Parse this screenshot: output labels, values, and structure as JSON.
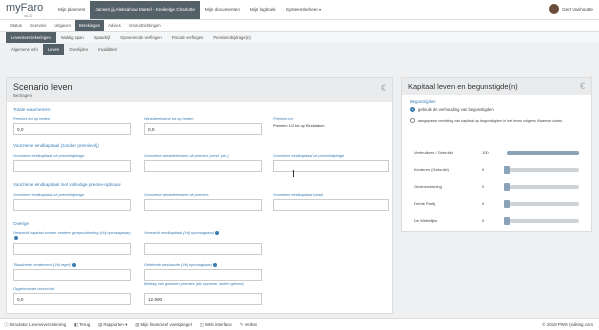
{
  "logo": {
    "name": "myFaro",
    "version": "v4.3"
  },
  "nav": [
    {
      "label": "Mijn planners",
      "active": false
    },
    {
      "label": "Jansen jij Aleksahow Martel - Kreikelge Charlotte",
      "active": true
    },
    {
      "label": "Mijn documenten",
      "active": false
    },
    {
      "label": "Mijn logboek",
      "active": false
    },
    {
      "label": "Systeembeheer",
      "active": false,
      "dropdown": true
    }
  ],
  "user": {
    "name": "Gert Vanhoutte"
  },
  "subnav": [
    {
      "label": "Status",
      "active": false
    },
    {
      "label": "Scenario",
      "active": false
    },
    {
      "label": "Uitgaven",
      "active": false
    },
    {
      "label": "Berekingen",
      "active": true
    },
    {
      "label": "Advies",
      "active": false
    },
    {
      "label": "Vooruitzichtingen",
      "active": false
    }
  ],
  "tabs1": [
    {
      "label": "Levensverzekeringen",
      "active": true
    },
    {
      "label": "Waldig span",
      "active": false
    },
    {
      "label": "Spaarbijf",
      "active": false
    },
    {
      "label": "Opvoerende verfingen",
      "active": false
    },
    {
      "label": "Fiscale verfingen",
      "active": false
    },
    {
      "label": "Pensioenbijdrage(n)",
      "active": false
    }
  ],
  "tabs2": [
    {
      "label": "Algemene info",
      "active": false
    },
    {
      "label": "Leven",
      "active": true
    },
    {
      "label": "Overlijden",
      "active": false
    },
    {
      "label": "Invaliditeit",
      "active": false
    }
  ],
  "left": {
    "title": "Scenario leven",
    "subtitle": "Bedragen",
    "sections": {
      "totaal": "Totale waarnemen",
      "eindkapitaal": "Voorziene eindkapitaal (zonder premievrij)",
      "winstdeelname": "Voorziene eindkapitaal met volledige premie-opbouw",
      "overige": "Overige"
    },
    "fields": {
      "premies_lbl": "Premies tot op heden",
      "premies_val": "0,0",
      "winstdeel_lbl": "Winstdeelname tot op heden",
      "winstdeel_val": "0,0",
      "premies2_lbl": "Premies tot",
      "premies2_text": "Premien 1/2 tot op Einddatum",
      "ek1_lbl": "Voorziene eindkapitaal uit premiebijdrage",
      "ek2_lbl": "Voorziene winstdeelname uit premies (rend. per.)",
      "ek3_lbl": "Voorziene eindkapitaal uit premiebijdrage",
      "v1_lbl": "Voorziene eindkapitaal uit premiebijdrage",
      "v2_lbl": "Voorziene winstdeelname uit premies",
      "v3_lbl": "Voorziene eindkapitaal totaal",
      "o1_lbl": "Verwacht kapitaal zonder verdere groepsuitkering (Vrij opvraagbaar)",
      "o2_lbl": "Verwacht eindkapitaal (Vrij opvraagbaar)",
      "o3_lbl": "Totaalnetto rendement (Vrij regel)",
      "o4_lbl": "Geldende beslaande (Vrij opvraagbaar)",
      "o5_lbl": "Opgebouwde voorschot",
      "o5_val": "0,0",
      "o6_lbl": "Bedrag van gesloten premies (als opname, indien geheel)",
      "o6_val": "12.900"
    }
  },
  "right": {
    "title": "Kapitaal leven en begunstigde(n)",
    "begunstigde_lbl": "Begunstigden",
    "opt1": "gebruik de verhouding van begunstigden",
    "opt2": "aangepaste verdeling van kapitaal op begunstigden in het leven volgens Vlaamse codes",
    "sliders": [
      {
        "name": "Verbruikers / Gebruikt",
        "value": "100",
        "pct": 100
      },
      {
        "name": "Kinderen (Gebruikt)",
        "value": "0",
        "pct": 0
      },
      {
        "name": "Gezinsrekening",
        "value": "0",
        "pct": 0
      },
      {
        "name": "Derde Partij",
        "value": "0",
        "pct": 0
      },
      {
        "name": "De Wettelijke",
        "value": "0",
        "pct": 0
      }
    ]
  },
  "footer": [
    {
      "label": "Simulator Levensverzekering",
      "icon": "info-icon"
    },
    {
      "label": "Terug",
      "icon": "back-icon"
    },
    {
      "label": "Rapporten",
      "icon": "report-icon"
    },
    {
      "label": "Mijn financieel voetspiegel",
      "icon": "chart-icon"
    },
    {
      "label": "Web interface",
      "icon": "web-icon"
    },
    {
      "label": "Verkst",
      "icon": "tool-icon"
    }
  ],
  "footer_right": "© 2019 PWS (editing.com"
}
